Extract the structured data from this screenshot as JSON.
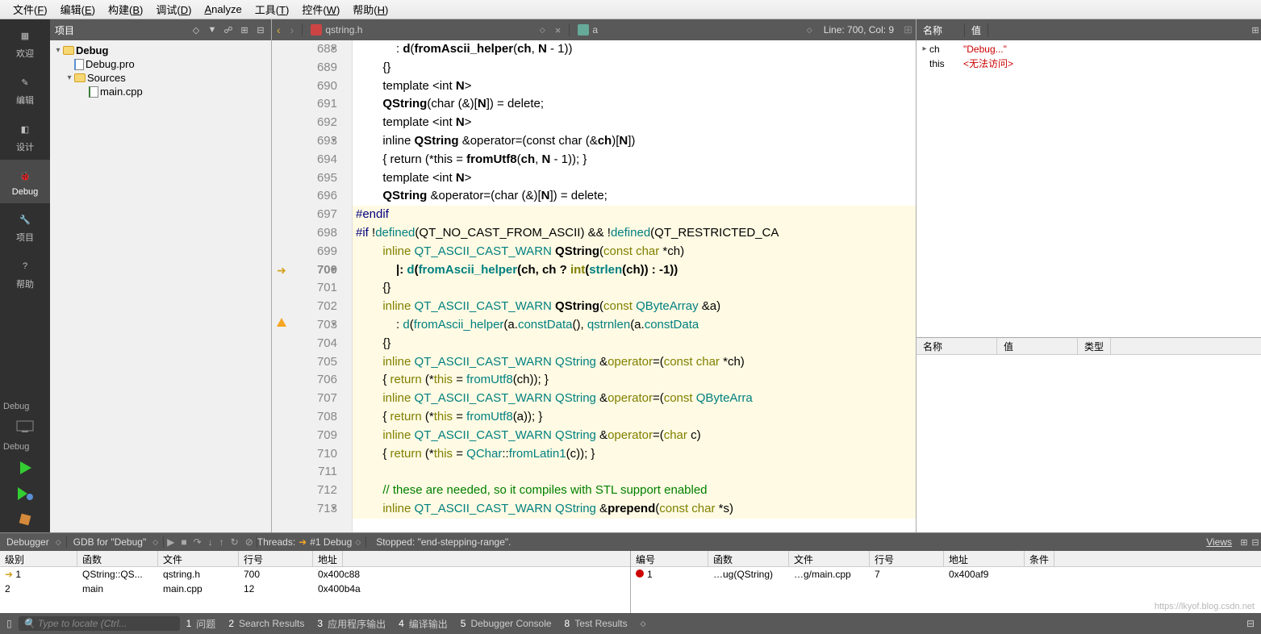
{
  "menubar": [
    {
      "label": "文件",
      "u": "F"
    },
    {
      "label": "编辑",
      "u": "E"
    },
    {
      "label": "构建",
      "u": "B"
    },
    {
      "label": "调试",
      "u": "D"
    },
    {
      "label": "Analyze",
      "u": "A"
    },
    {
      "label": "工具",
      "u": "T"
    },
    {
      "label": "控件",
      "u": "W"
    },
    {
      "label": "帮助",
      "u": "H"
    }
  ],
  "modebar": [
    {
      "label": "欢迎",
      "active": false
    },
    {
      "label": "编辑",
      "active": false
    },
    {
      "label": "设计",
      "active": false
    },
    {
      "label": "Debug",
      "active": true
    },
    {
      "label": "项目",
      "active": false
    },
    {
      "label": "帮助",
      "active": false
    }
  ],
  "modebar_debug_label": "Debug",
  "project_panel": {
    "title": "项目",
    "tree": [
      {
        "indent": 0,
        "expander": "▾",
        "icon": "folder",
        "label": "Debug",
        "bold": true
      },
      {
        "indent": 1,
        "expander": "",
        "icon": "pro",
        "label": "Debug.pro"
      },
      {
        "indent": 1,
        "expander": "▾",
        "icon": "folder",
        "label": "Sources"
      },
      {
        "indent": 2,
        "expander": "",
        "icon": "cpp",
        "label": "main.cpp"
      }
    ]
  },
  "editor_toolbar": {
    "filename": "qstring.h",
    "class": "a",
    "linecol": "Line: 700, Col: 9"
  },
  "code_lines": [
    {
      "n": 688,
      "fold": "▾",
      "html": "            : <b>d</b>(<b>fromAscii_helper</b>(<b>ch</b>, <b>N</b> - 1))"
    },
    {
      "n": 689,
      "html": "        {}"
    },
    {
      "n": 690,
      "html": "        template &lt;int <b>N</b>&gt;"
    },
    {
      "n": 691,
      "html": "        <b>QString</b>(char (&amp;)[<b>N</b>]) = delete;"
    },
    {
      "n": 692,
      "html": "        template &lt;int <b>N</b>&gt;"
    },
    {
      "n": 693,
      "fold": "▾",
      "html": "        inline <b>QString</b> &amp;operator=(const char (&amp;<b>ch</b>)[<b>N</b>])"
    },
    {
      "n": 694,
      "html": "        { return (*this = <b>fromUtf8</b>(<b>ch</b>, <b>N</b> - 1)); }"
    },
    {
      "n": 695,
      "html": "        template &lt;int <b>N</b>&gt;"
    },
    {
      "n": 696,
      "html": "        <b>QString</b> &amp;operator=(char (&amp;)[<b>N</b>]) = delete;"
    },
    {
      "n": 697,
      "html": "<span class=\"pre\">#endif</span>",
      "hl": true
    },
    {
      "n": 698,
      "html": "<span class=\"pre\">#if</span> !<span class=\"id-green\">defined</span>(QT_NO_CAST_FROM_ASCII) &amp;&amp; !<span class=\"id-green\">defined</span>(QT_RESTRICTED_CA",
      "hl": true
    },
    {
      "n": 699,
      "html": "        <span class=\"kw\">inline</span> <span class=\"id-green\">QT_ASCII_CAST_WARN</span> <b>QString</b>(<span class=\"kw\">const</span> <span class=\"kw\">char</span> *ch)",
      "hl": true
    },
    {
      "n": 700,
      "fold": "▾",
      "html": "            <b>|</b>: <span class=\"id-green\">d</span>(<span class=\"id-green\">fromAscii_helper</span>(ch, ch ? <span class=\"kw\">int</span>(<span class=\"id-green\">strlen</span>(ch)) : -1))",
      "hl": true,
      "current": true,
      "gutter_arrow": true
    },
    {
      "n": 701,
      "html": "        {}",
      "hl": true
    },
    {
      "n": 702,
      "html": "        <span class=\"kw\">inline</span> <span class=\"id-green\">QT_ASCII_CAST_WARN</span> <b>QString</b>(<span class=\"kw\">const</span> <span class=\"id-green\">QByteArray</span> &amp;a)",
      "hl": true
    },
    {
      "n": 703,
      "fold": "▾",
      "html": "            : <span class=\"id-green\">d</span>(<span class=\"id-green\">fromAscii_helper</span>(a.<span class=\"id-green\">constData</span>(), <span class=\"id-green\">qstrnlen</span>(a.<span class=\"id-green\">constData</span>",
      "hl": true,
      "warn": true
    },
    {
      "n": 704,
      "html": "        {}",
      "hl": true
    },
    {
      "n": 705,
      "html": "        <span class=\"kw\">inline</span> <span class=\"id-green\">QT_ASCII_CAST_WARN</span> <span class=\"id-green\">QString</span> &amp;<span class=\"kw\">operator</span>=(<span class=\"kw\">const</span> <span class=\"kw\">char</span> *ch)",
      "hl": true
    },
    {
      "n": 706,
      "html": "        { <span class=\"kw\">return</span> (*<span class=\"kw\">this</span> = <span class=\"id-green\">fromUtf8</span>(ch)); }",
      "hl": true
    },
    {
      "n": 707,
      "html": "        <span class=\"kw\">inline</span> <span class=\"id-green\">QT_ASCII_CAST_WARN</span> <span class=\"id-green\">QString</span> &amp;<span class=\"kw\">operator</span>=(<span class=\"kw\">const</span> <span class=\"id-green\">QByteArra</span>",
      "hl": true
    },
    {
      "n": 708,
      "html": "        { <span class=\"kw\">return</span> (*<span class=\"kw\">this</span> = <span class=\"id-green\">fromUtf8</span>(a)); }",
      "hl": true
    },
    {
      "n": 709,
      "html": "        <span class=\"kw\">inline</span> <span class=\"id-green\">QT_ASCII_CAST_WARN</span> <span class=\"id-green\">QString</span> &amp;<span class=\"kw\">operator</span>=(<span class=\"kw\">char</span> c)",
      "hl": true
    },
    {
      "n": 710,
      "html": "        { <span class=\"kw\">return</span> (*<span class=\"kw\">this</span> = <span class=\"id-green\">QChar</span>::<span class=\"id-green\">fromLatin1</span>(c)); }",
      "hl": true
    },
    {
      "n": 711,
      "html": "",
      "hl": true
    },
    {
      "n": 712,
      "html": "        <span class=\"comment\">// these are needed, so it compiles with STL support enabled</span>",
      "hl": true
    },
    {
      "n": 713,
      "fold": "▾",
      "html": "        <span class=\"kw\">inline</span> <span class=\"id-green\">QT_ASCII_CAST_WARN</span> <span class=\"id-green\">QString</span> &amp;<b>prepend</b>(<span class=\"kw\">const</span> <span class=\"kw\">char</span> *s)",
      "hl": true
    }
  ],
  "locals_panel": {
    "cols": [
      "名称",
      "值"
    ],
    "rows": [
      {
        "exp": "▸",
        "name": "ch",
        "value": "\"Debug...\""
      },
      {
        "exp": "",
        "name": "this",
        "value": "<无法访问>"
      }
    ],
    "bottom_cols": [
      "名称",
      "值",
      "类型"
    ]
  },
  "debugger_toolbar": {
    "label": "Debugger",
    "config": "GDB for \"Debug\"",
    "threads_label": "Threads:",
    "thread": "#1 Debug",
    "status": "Stopped: \"end-stepping-range\".",
    "views": "Views"
  },
  "stack_panel": {
    "cols": {
      "level": "级别",
      "func": "函数",
      "file": "文件",
      "line": "行号",
      "addr": "地址"
    },
    "rows": [
      {
        "level": "1",
        "func": "QString::QS...",
        "file": "qstring.h",
        "line": "700",
        "addr": "0x400c88",
        "arrow": true
      },
      {
        "level": "2",
        "func": "main",
        "file": "main.cpp",
        "line": "12",
        "addr": "0x400b4a"
      }
    ]
  },
  "bp_panel": {
    "cols": {
      "num": "编号",
      "func": "函数",
      "file": "文件",
      "line": "行号",
      "addr": "地址",
      "cond": "条件"
    },
    "rows": [
      {
        "num": "1",
        "func": "…ug(QString)",
        "file": "…g/main.cpp",
        "line": "7",
        "addr": "0x400af9"
      }
    ]
  },
  "statusbar": {
    "search_placeholder": "Type to locate (Ctrl...",
    "items": [
      {
        "n": "1",
        "label": "问题"
      },
      {
        "n": "2",
        "label": "Search Results"
      },
      {
        "n": "3",
        "label": "应用程序输出"
      },
      {
        "n": "4",
        "label": "编译输出"
      },
      {
        "n": "5",
        "label": "Debugger Console"
      },
      {
        "n": "8",
        "label": "Test Results"
      }
    ]
  },
  "watermark": "https://lkyof.blog.csdn.net"
}
